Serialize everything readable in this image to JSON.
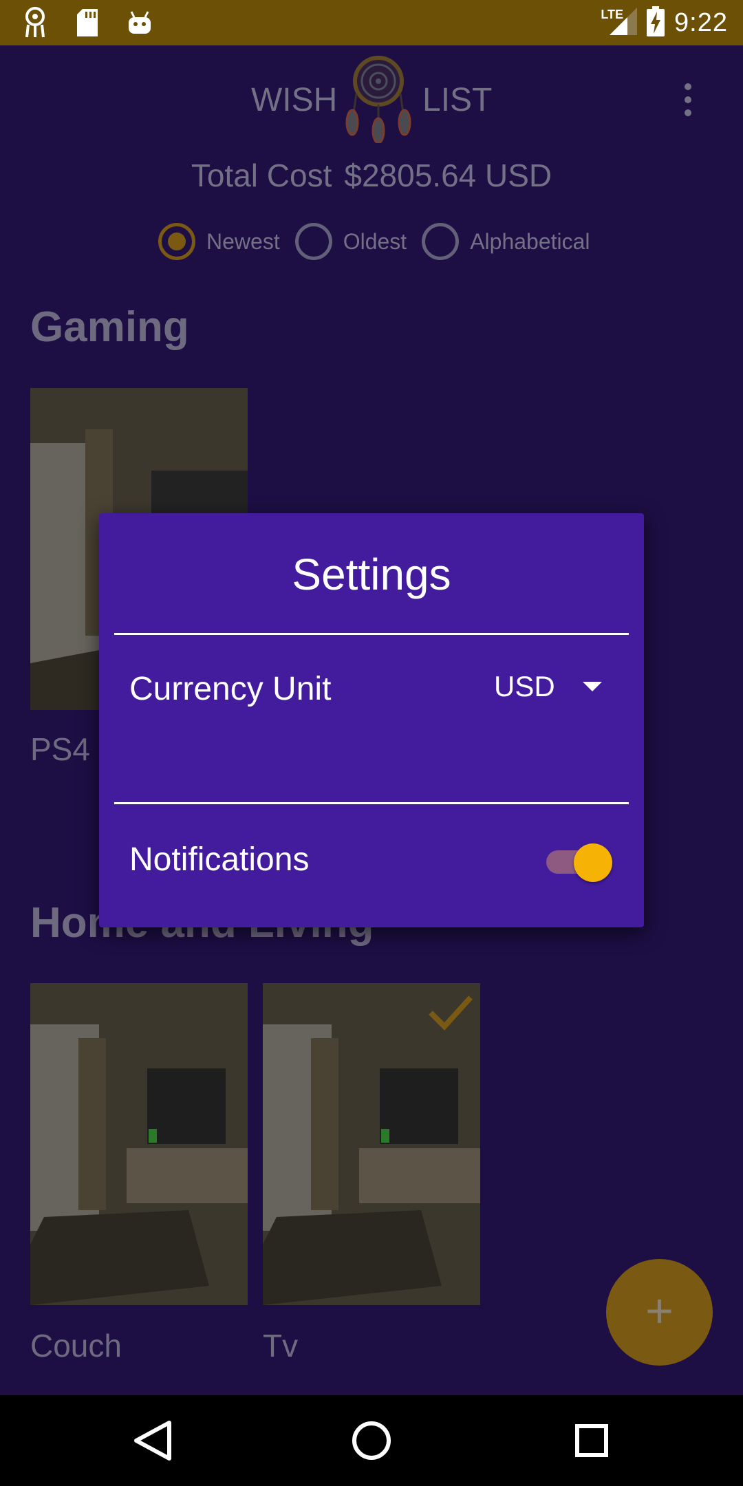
{
  "status_bar": {
    "network": "LTE",
    "time": "9:22",
    "left_icons": [
      "dreamcatcher-icon",
      "sd-card-icon",
      "android-icon"
    ],
    "right_icons": [
      "signal-icon",
      "battery-charging-icon"
    ]
  },
  "app": {
    "title_left": "WISH",
    "title_right": "LIST",
    "total_label": "Total Cost",
    "total_amount": "$2805.64 USD",
    "sort_options": [
      {
        "label": "Newest",
        "checked": true
      },
      {
        "label": "Oldest",
        "checked": false
      },
      {
        "label": "Alphabetical",
        "checked": false
      }
    ],
    "categories": [
      {
        "name": "Gaming",
        "items": [
          {
            "label": "PS4",
            "checked": false
          }
        ]
      },
      {
        "name": "Home and Living",
        "items": [
          {
            "label": "Couch",
            "checked": false
          },
          {
            "label": "Tv",
            "checked": true
          }
        ]
      }
    ],
    "fab_icon": "plus-icon"
  },
  "dialog": {
    "title": "Settings",
    "currency_label": "Currency Unit",
    "currency_value": "USD",
    "notifications_label": "Notifications",
    "notifications_on": true
  },
  "nav_bar": {
    "icons": [
      "back-icon",
      "home-icon",
      "recents-icon"
    ]
  },
  "colors": {
    "status_bar": "#6b5006",
    "app_background": "#1d0e44",
    "dialog_background": "#421c9c",
    "accent": "#f7b206"
  }
}
